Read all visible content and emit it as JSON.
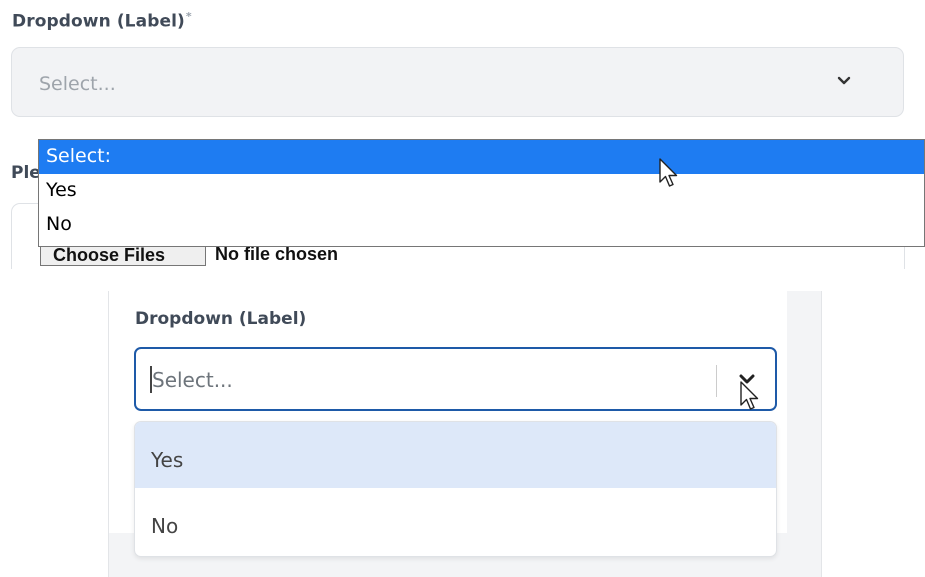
{
  "top": {
    "label": "Dropdown (Label)",
    "required_mark": "*",
    "select": {
      "placeholder": "Select..."
    },
    "partial_label": "Ple",
    "file_input": {
      "button_label": "Choose Files",
      "status": "No file chosen"
    },
    "native_options": [
      {
        "label": "Select:",
        "selected": true
      },
      {
        "label": "Yes",
        "selected": false
      },
      {
        "label": "No",
        "selected": false
      }
    ]
  },
  "bottom": {
    "label": "Dropdown (Label)",
    "select": {
      "placeholder": "Select..."
    },
    "menu_options": [
      {
        "label": "Yes",
        "highlighted": true
      },
      {
        "label": "No",
        "highlighted": false
      }
    ]
  },
  "colors": {
    "native_selected": "#1e7cf2",
    "focus_border": "#1e5aa8",
    "option_highlight": "#dde8f9",
    "select_background": "#f2f3f5"
  },
  "icons": [
    "chevron-down-icon",
    "mouse-cursor-icon"
  ]
}
